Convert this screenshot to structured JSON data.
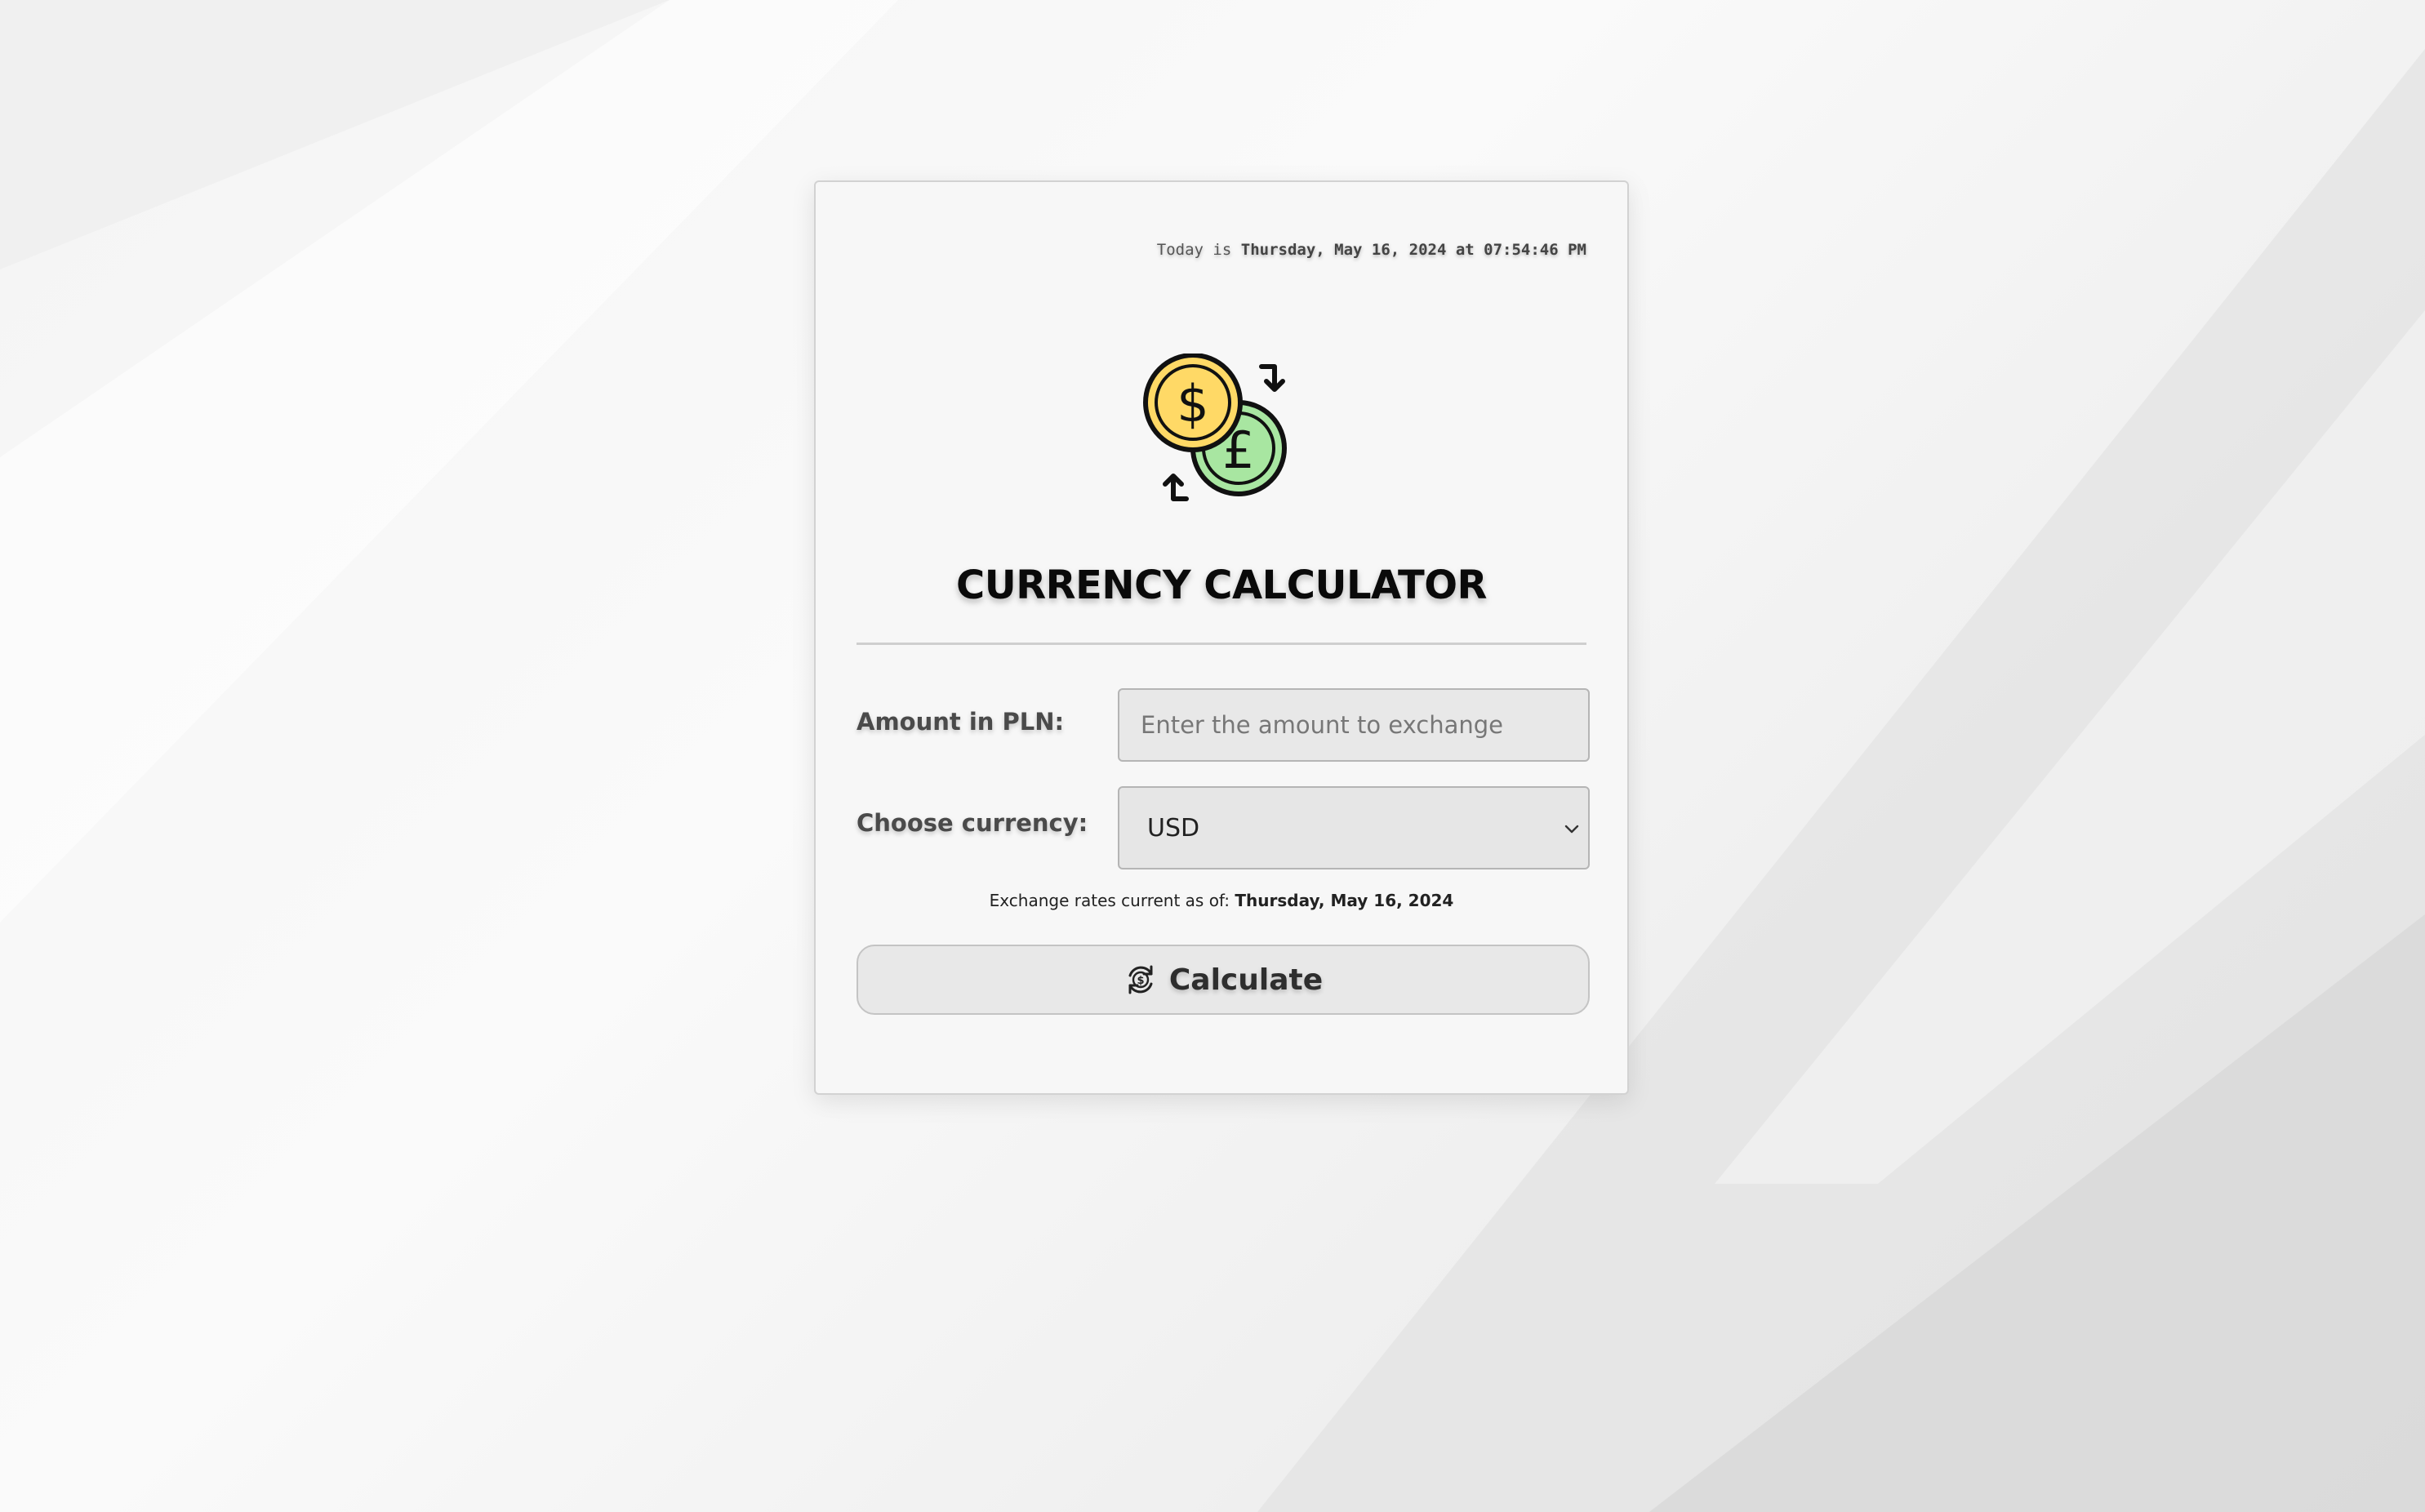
{
  "header": {
    "date_prefix": "Today is ",
    "date_value": "Thursday, May 16, 2024 at 07:54:46 PM"
  },
  "logo": {
    "icon": "currency-exchange-icon",
    "dollar_symbol": "$",
    "pound_symbol": "£",
    "colors": {
      "dollar_coin": "#ffd966",
      "pound_coin": "#a8e6a1",
      "outline": "#111111"
    }
  },
  "title": "CURRENCY CALCULATOR",
  "form": {
    "amount_label": "Amount in PLN:",
    "amount_placeholder": "Enter the amount to exchange",
    "amount_value": "",
    "currency_label": "Choose currency:",
    "currency_selected": "USD"
  },
  "rates": {
    "prefix": "Exchange rates current as of: ",
    "date": "Thursday, May 16, 2024"
  },
  "button": {
    "label": "Calculate",
    "icon": "currency-refresh-icon"
  }
}
